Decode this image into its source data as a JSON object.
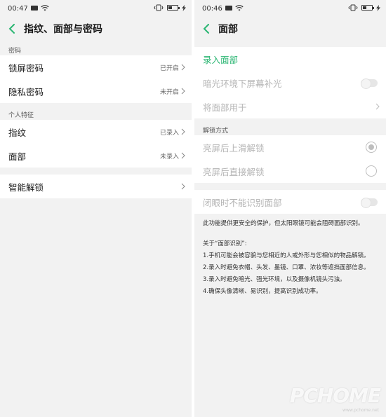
{
  "left": {
    "status": {
      "time": "00:47"
    },
    "title": "指纹、面部与密码",
    "sections": [
      {
        "label": "密码",
        "rows": [
          {
            "label": "锁屏密码",
            "value": "已开启"
          },
          {
            "label": "隐私密码",
            "value": "未开启"
          }
        ]
      },
      {
        "label": "个人特征",
        "rows": [
          {
            "label": "指纹",
            "value": "已录入"
          },
          {
            "label": "面部",
            "value": "未录入"
          }
        ]
      }
    ],
    "smart_unlock": "智能解锁"
  },
  "right": {
    "status": {
      "time": "00:46"
    },
    "title": "面部",
    "enroll": "录入面部",
    "dim_fill": "暗光环境下屏幕补光",
    "use_face_for": "将面部用于",
    "unlock_section": "解锁方式",
    "unlock_swipe": "亮屏后上滑解锁",
    "unlock_direct": "亮屏后直接解锁",
    "closed_eyes": "闭眼时不能识别面部",
    "note_intro": "此功能提供更安全的保护，但太阳眼镜可能会阻碍面部识别。",
    "about_title": "关于“面部识别”:",
    "about_items": [
      "1.手机可能会被容貌与您相近的人或外形与您相似的物品解锁。",
      "2.录入时避免衣帽、头发、墨镜、口罩、浓妆等遮挡面部信息。",
      "3.录入时避免暗光、强光环境，以及摄像机镜头污浊。",
      "4.确保头像清晰、易识别，提高识别成功率。"
    ]
  },
  "watermark": {
    "logo": "PCHOME",
    "site": "www.pchome.net"
  },
  "colors": {
    "accent_green": "#2bb673",
    "background": "#f2f2f2"
  }
}
